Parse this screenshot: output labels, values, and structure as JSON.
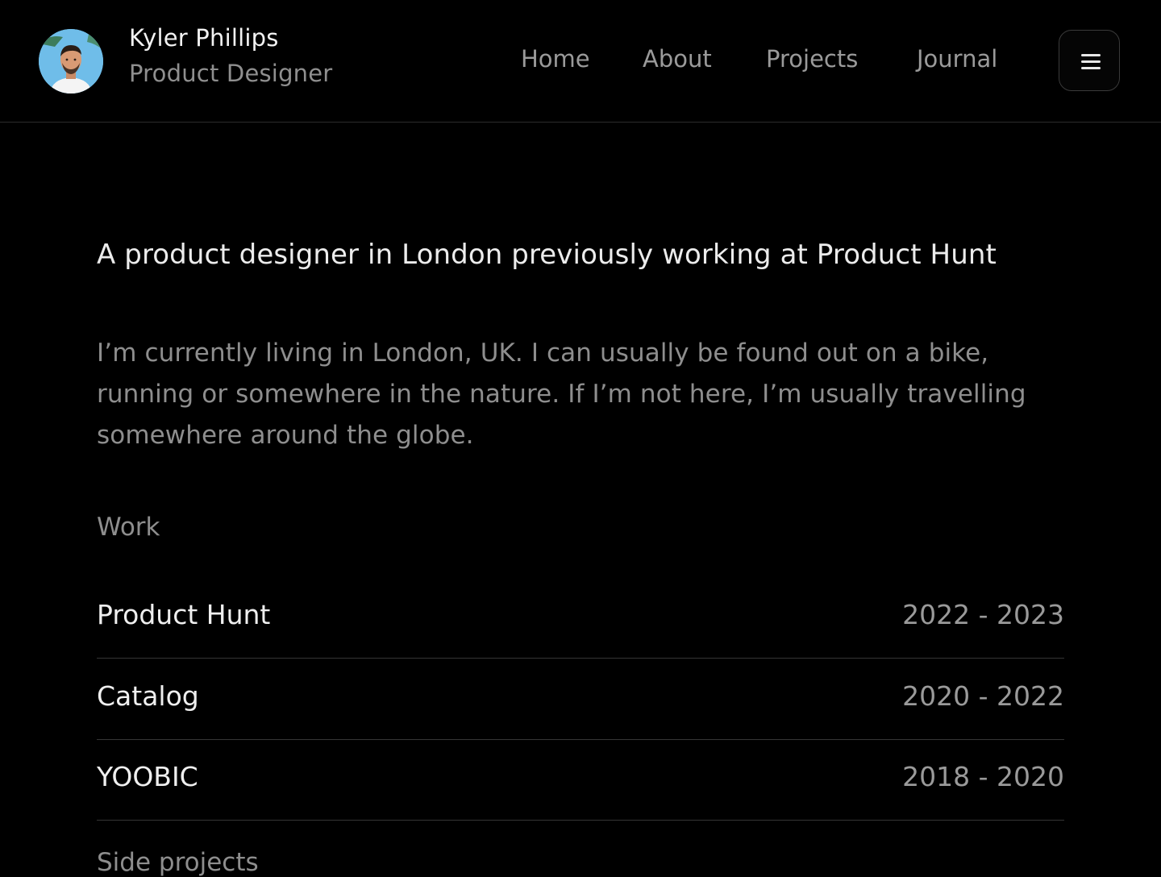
{
  "header": {
    "name": "Kyler Phillips",
    "role": "Product Designer",
    "nav": [
      "Home",
      "About",
      "Projects",
      "Journal"
    ]
  },
  "intro": "A product designer in London previously working at Product Hunt",
  "bio": "I’m currently living in London, UK. I can usually be found out on a bike, running or somewhere in the nature. If I’m not here, I’m usually travelling somewhere around the globe.",
  "work": {
    "label": "Work",
    "items": [
      {
        "company": "Product Hunt",
        "years": "2022 - 2023"
      },
      {
        "company": "Catalog",
        "years": "2020 - 2022"
      },
      {
        "company": "YOOBIC",
        "years": "2018 - 2020"
      }
    ]
  },
  "side_projects": {
    "label": "Side projects"
  }
}
